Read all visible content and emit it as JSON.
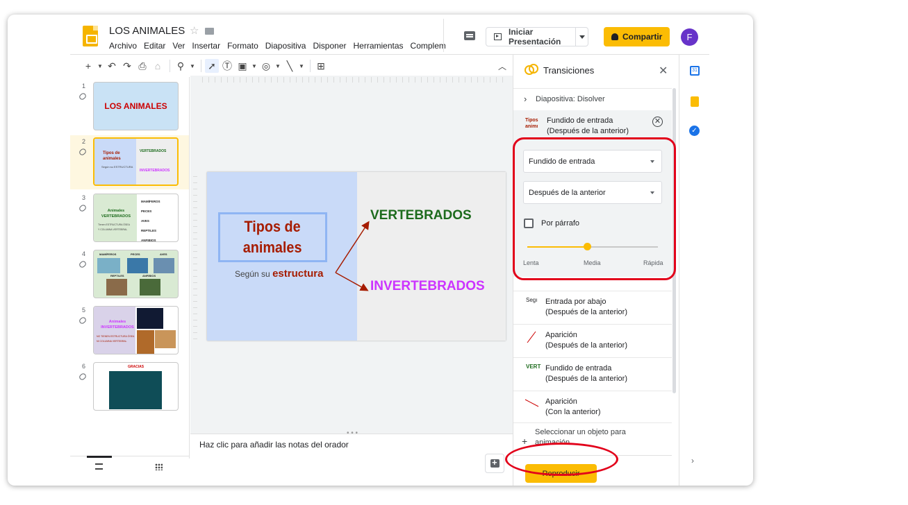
{
  "app": {
    "title": "LOS ANIMALES",
    "menu": [
      "Archivo",
      "Editar",
      "Ver",
      "Insertar",
      "Formato",
      "Diapositiva",
      "Disponer",
      "Herramientas",
      "Complementos"
    ],
    "present_label": "Iniciar Presentación",
    "share_label": "Compartir",
    "avatar_letter": "F"
  },
  "filmstrip": {
    "slides": [
      {
        "num": "1",
        "title": "LOS ANIMALES"
      },
      {
        "num": "2",
        "title": "Tipos de animales",
        "v": "VERTEBRADOS",
        "i": "INVERTEBRADOS",
        "sub": "Según su ESTRUCTURA"
      },
      {
        "num": "3",
        "title": "Animales VERTEBRADOS",
        "items": [
          "MAMÍFEROS",
          "PECES",
          "AVES",
          "REPTILES",
          "ANFIBIOS"
        ],
        "lines": [
          "Tienen ESTRUCTURA ÓSEA",
          "Y COLUMNA VERTEBRAL"
        ]
      },
      {
        "num": "4",
        "labels": [
          "MAMÍFEROS",
          "PECES",
          "AVES",
          "REPTILES",
          "ANFIBIOS"
        ]
      },
      {
        "num": "5",
        "title": "Animales INVERTEBRADOS",
        "lines": [
          "NO TIENEN ESTRUCTURA ÓSEA",
          "NI COLUMNA VERTEBRAL"
        ]
      },
      {
        "num": "6",
        "title": "GRACIAS"
      }
    ]
  },
  "slide": {
    "title_line1": "Tipos de",
    "title_line2": "animales",
    "subtitle_prefix": "Según su",
    "subtitle_word": "estructura",
    "vert": "VERTEBRADOS",
    "invert": "INVERTEBRADOS"
  },
  "notes": {
    "placeholder": "Haz clic para añadir las notas del orador"
  },
  "panel": {
    "title": "Transiciones",
    "slide_transition": "Diapositiva: Disolver",
    "current": {
      "thumb": "Tipos animı",
      "name": "Fundido de entrada",
      "timing": "(Después de la anterior)",
      "effect": "Fundido de entrada",
      "start": "Después de la anterior",
      "by_paragraph": "Por párrafo",
      "speed_labels": [
        "Lenta",
        "Media",
        "Rápida"
      ],
      "speed_fraction": 0.46
    },
    "items": [
      {
        "thumb": "Segı",
        "name": "Entrada por abajo",
        "timing": "(Después de la anterior)"
      },
      {
        "thumb": "",
        "name": "Aparición",
        "timing": "(Después de la anterior)"
      },
      {
        "thumb": "VERT",
        "name": "Fundido de entrada",
        "timing": "(Después de la anterior)"
      },
      {
        "thumb": "",
        "name": "Aparición",
        "timing": "(Con la anterior)"
      }
    ],
    "select_object": "Seleccionar un objeto para animación",
    "play_label": "Reproducir"
  },
  "colors": {
    "accent": "#fbbc04",
    "annotation": "#e2001a",
    "title_red": "#a61c00",
    "vert_green": "#1d6b1d",
    "invert_purple": "#cc33ff"
  }
}
